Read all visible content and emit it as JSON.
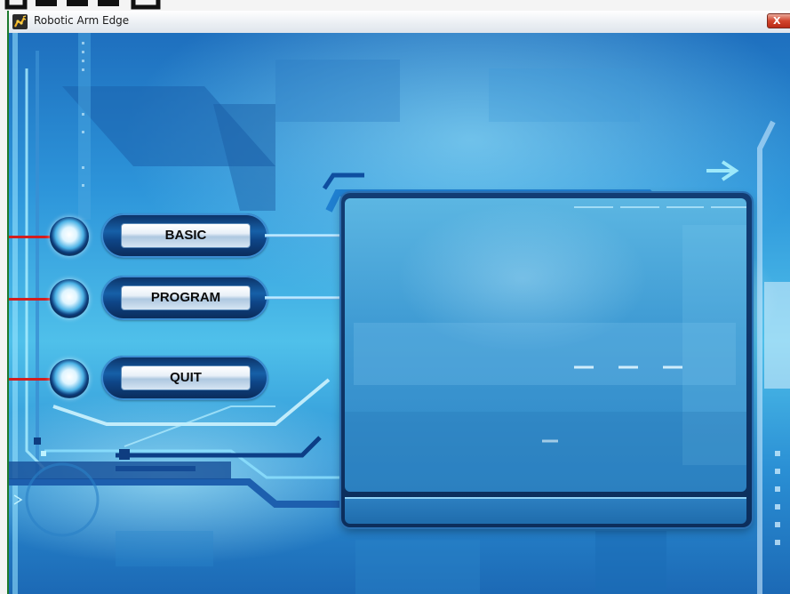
{
  "window": {
    "title": "Robotic Arm Edge",
    "close_glyph": "X"
  },
  "menu": {
    "buttons": [
      {
        "label": "BASIC"
      },
      {
        "label": "PROGRAM"
      },
      {
        "label": "QUIT"
      }
    ]
  },
  "icons": {
    "app": "robot-arm-icon",
    "close": "close-icon"
  },
  "colors": {
    "wire": "#d31e1e",
    "capsule": "#0e4587",
    "title_bar": "#eaeef3",
    "close_button": "#d2442c"
  }
}
